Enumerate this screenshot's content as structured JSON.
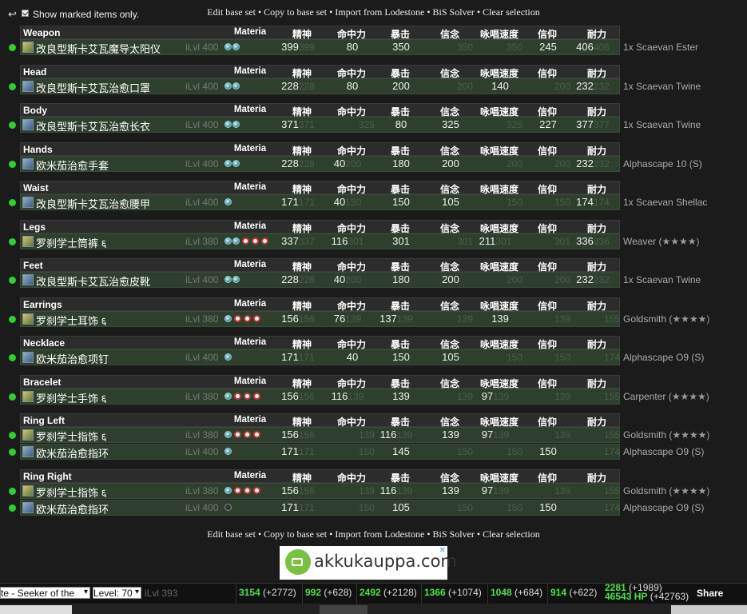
{
  "top": {
    "show_marked_label": "Show marked items only.",
    "links": [
      "Edit base set",
      "Copy to base set",
      "Import from Lodestone",
      "BiS Solver",
      "Clear selection"
    ]
  },
  "headers": {
    "materia": "Materia",
    "stats": [
      "精神",
      "命中力",
      "暴击",
      "信念",
      "咏唱速度",
      "信仰",
      "耐力"
    ]
  },
  "slots": [
    {
      "slot": "Weapon",
      "items": [
        {
          "name": "改良型斯卡艾瓦魔导太阳仪",
          "ilvl": "iLvl 400",
          "materia": [
            "b",
            "b"
          ],
          "icon": "g",
          "note": "1x Scaevan Ester",
          "stars": "",
          "stats": [
            {
              "v": "399",
              "c": "399"
            },
            {
              "v": "80",
              "c": ""
            },
            {
              "v": "350",
              "c": ""
            },
            {
              "v": "",
              "c": "350"
            },
            {
              "v": "",
              "c": "350"
            },
            {
              "v": "245",
              "c": ""
            },
            {
              "v": "406",
              "c": "406"
            }
          ]
        }
      ]
    },
    {
      "slot": "Head",
      "items": [
        {
          "name": "改良型斯卡艾瓦治愈口罩",
          "ilvl": "iLvl 400",
          "materia": [
            "b",
            "b"
          ],
          "icon": "b",
          "note": "1x Scaevan Twine",
          "stars": "",
          "stats": [
            {
              "v": "228",
              "c": "228"
            },
            {
              "v": "80",
              "c": ""
            },
            {
              "v": "200",
              "c": ""
            },
            {
              "v": "",
              "c": "200"
            },
            {
              "v": "140",
              "c": ""
            },
            {
              "v": "",
              "c": "200"
            },
            {
              "v": "232",
              "c": "232"
            }
          ]
        }
      ]
    },
    {
      "slot": "Body",
      "items": [
        {
          "name": "改良型斯卡艾瓦治愈长衣",
          "ilvl": "iLvl 400",
          "materia": [
            "b",
            "b"
          ],
          "icon": "b",
          "note": "1x Scaevan Twine",
          "stars": "",
          "stats": [
            {
              "v": "371",
              "c": "371"
            },
            {
              "v": "",
              "c": "325"
            },
            {
              "v": "80",
              "c": ""
            },
            {
              "v": "325",
              "c": ""
            },
            {
              "v": "",
              "c": "325"
            },
            {
              "v": "227",
              "c": ""
            },
            {
              "v": "377",
              "c": "377"
            }
          ]
        }
      ]
    },
    {
      "slot": "Hands",
      "items": [
        {
          "name": "欧米茄治愈手套",
          "ilvl": "iLvl 400",
          "materia": [
            "b",
            "b"
          ],
          "icon": "b",
          "note": "Alphascape 10 (S)",
          "stars": "",
          "stats": [
            {
              "v": "228",
              "c": "228"
            },
            {
              "v": "40",
              "c": "200"
            },
            {
              "v": "180",
              "c": ""
            },
            {
              "v": "200",
              "c": ""
            },
            {
              "v": "",
              "c": "200"
            },
            {
              "v": "",
              "c": "200"
            },
            {
              "v": "232",
              "c": "232"
            }
          ]
        }
      ]
    },
    {
      "slot": "Waist",
      "items": [
        {
          "name": "改良型斯卡艾瓦治愈腰甲",
          "ilvl": "iLvl 400",
          "materia": [
            "b"
          ],
          "icon": "b",
          "note": "1x Scaevan Shellac",
          "stars": "",
          "stats": [
            {
              "v": "171",
              "c": "171"
            },
            {
              "v": "40",
              "c": "150"
            },
            {
              "v": "150",
              "c": ""
            },
            {
              "v": "105",
              "c": ""
            },
            {
              "v": "",
              "c": "150"
            },
            {
              "v": "",
              "c": "150"
            },
            {
              "v": "174",
              "c": "174"
            }
          ]
        }
      ]
    },
    {
      "slot": "Legs",
      "items": [
        {
          "name": "罗刹学士筒裤 ६",
          "ilvl": "iLvl 380",
          "materia": [
            "b",
            "b",
            "r",
            "r",
            "r"
          ],
          "icon": "g",
          "note": "Weaver (",
          "stars": "★★★★)",
          "stats": [
            {
              "v": "337",
              "c": "337"
            },
            {
              "v": "116",
              "c": "301"
            },
            {
              "v": "301",
              "c": ""
            },
            {
              "v": "",
              "c": "301"
            },
            {
              "v": "211",
              "c": "301"
            },
            {
              "v": "",
              "c": "301"
            },
            {
              "v": "336",
              "c": "336"
            }
          ]
        }
      ]
    },
    {
      "slot": "Feet",
      "items": [
        {
          "name": "改良型斯卡艾瓦治愈皮靴",
          "ilvl": "iLvl 400",
          "materia": [
            "b",
            "b"
          ],
          "icon": "b",
          "note": "1x Scaevan Twine",
          "stars": "",
          "stats": [
            {
              "v": "228",
              "c": "228"
            },
            {
              "v": "40",
              "c": "200"
            },
            {
              "v": "180",
              "c": ""
            },
            {
              "v": "200",
              "c": ""
            },
            {
              "v": "",
              "c": "200"
            },
            {
              "v": "",
              "c": "200"
            },
            {
              "v": "232",
              "c": "232"
            }
          ]
        }
      ]
    },
    {
      "slot": "Earrings",
      "items": [
        {
          "name": "罗刹学士耳饰 ६",
          "ilvl": "iLvl 380",
          "materia": [
            "b",
            "r",
            "r",
            "r"
          ],
          "icon": "g",
          "note": "Goldsmith (",
          "stars": "★★★★)",
          "stats": [
            {
              "v": "156",
              "c": "156"
            },
            {
              "v": "76",
              "c": "139"
            },
            {
              "v": "137",
              "c": "139"
            },
            {
              "v": "",
              "c": "139"
            },
            {
              "v": "139",
              "c": ""
            },
            {
              "v": "",
              "c": "139"
            },
            {
              "v": "",
              "c": "155"
            }
          ]
        }
      ]
    },
    {
      "slot": "Necklace",
      "items": [
        {
          "name": "欧米茄治愈项钉",
          "ilvl": "iLvl 400",
          "materia": [
            "b"
          ],
          "icon": "b",
          "note": "Alphascape O9 (S)",
          "stars": "",
          "stats": [
            {
              "v": "171",
              "c": "171"
            },
            {
              "v": "40",
              "c": ""
            },
            {
              "v": "150",
              "c": ""
            },
            {
              "v": "105",
              "c": ""
            },
            {
              "v": "",
              "c": "150"
            },
            {
              "v": "",
              "c": "150"
            },
            {
              "v": "",
              "c": "174"
            }
          ]
        }
      ]
    },
    {
      "slot": "Bracelet",
      "items": [
        {
          "name": "罗刹学士手饰 ६",
          "ilvl": "iLvl 380",
          "materia": [
            "b",
            "r",
            "r",
            "r"
          ],
          "icon": "g",
          "note": "Carpenter (",
          "stars": "★★★★)",
          "stats": [
            {
              "v": "156",
              "c": "156"
            },
            {
              "v": "116",
              "c": "139"
            },
            {
              "v": "139",
              "c": ""
            },
            {
              "v": "",
              "c": "139"
            },
            {
              "v": "97",
              "c": "139"
            },
            {
              "v": "",
              "c": "139"
            },
            {
              "v": "",
              "c": "155"
            }
          ]
        }
      ]
    },
    {
      "slot": "Ring Left",
      "items": [
        {
          "name": "罗刹学士指饰 ६",
          "ilvl": "iLvl 380",
          "materia": [
            "b",
            "r",
            "r",
            "r"
          ],
          "icon": "g",
          "note": "Goldsmith (",
          "stars": "★★★★)",
          "stats": [
            {
              "v": "156",
              "c": "156"
            },
            {
              "v": "",
              "c": "139"
            },
            {
              "v": "116",
              "c": "139"
            },
            {
              "v": "139",
              "c": ""
            },
            {
              "v": "97",
              "c": "139"
            },
            {
              "v": "",
              "c": "139"
            },
            {
              "v": "",
              "c": "155"
            }
          ]
        },
        {
          "name": "欧米茄治愈指环",
          "ilvl": "iLvl 400",
          "materia": [
            "b"
          ],
          "icon": "b",
          "note": "Alphascape O9 (S)",
          "stars": "",
          "stats": [
            {
              "v": "171",
              "c": "171"
            },
            {
              "v": "",
              "c": "150"
            },
            {
              "v": "145",
              "c": ""
            },
            {
              "v": "",
              "c": "150"
            },
            {
              "v": "",
              "c": "150"
            },
            {
              "v": "150",
              "c": ""
            },
            {
              "v": "",
              "c": "174"
            }
          ]
        }
      ]
    },
    {
      "slot": "Ring Right",
      "items": [
        {
          "name": "罗刹学士指饰 ६",
          "ilvl": "iLvl 380",
          "materia": [
            "b",
            "r",
            "r",
            "r"
          ],
          "icon": "g",
          "note": "Goldsmith (",
          "stars": "★★★★)",
          "stats": [
            {
              "v": "156",
              "c": "156"
            },
            {
              "v": "",
              "c": "139"
            },
            {
              "v": "116",
              "c": "139"
            },
            {
              "v": "139",
              "c": ""
            },
            {
              "v": "97",
              "c": "139"
            },
            {
              "v": "",
              "c": "139"
            },
            {
              "v": "",
              "c": "155"
            }
          ]
        },
        {
          "name": "欧米茄治愈指环",
          "ilvl": "iLvl 400",
          "materia": [
            "e"
          ],
          "icon": "b",
          "note": "Alphascape O9 (S)",
          "stars": "",
          "stats": [
            {
              "v": "171",
              "c": "171"
            },
            {
              "v": "",
              "c": "150"
            },
            {
              "v": "105",
              "c": ""
            },
            {
              "v": "",
              "c": "150"
            },
            {
              "v": "",
              "c": "150"
            },
            {
              "v": "150",
              "c": ""
            },
            {
              "v": "",
              "c": "174"
            }
          ]
        }
      ]
    }
  ],
  "ad": {
    "text": "akkukauppa.com",
    "close": "✕"
  },
  "bottom": {
    "job_select": "te - Seeker of the",
    "level_select": "Level: 70",
    "ilvl": "iLvl 393",
    "stats": [
      {
        "v": "3154",
        "d": "(+2772)"
      },
      {
        "v": "992",
        "d": "(+628)"
      },
      {
        "v": "2492",
        "d": "(+2128)"
      },
      {
        "v": "1366",
        "d": "(+1074)"
      },
      {
        "v": "1048",
        "d": "(+684)"
      },
      {
        "v": "914",
        "d": "(+622)"
      }
    ],
    "last_top": {
      "v": "2281",
      "d": "(+1989)"
    },
    "last_bottom": {
      "v": "46543 HP",
      "d": "(+42763)"
    },
    "share": "Share"
  },
  "colors": {
    "accent_green": "#4de04d",
    "row_bg": "#2a3a2a",
    "page_bg": "#1b1b1b"
  }
}
